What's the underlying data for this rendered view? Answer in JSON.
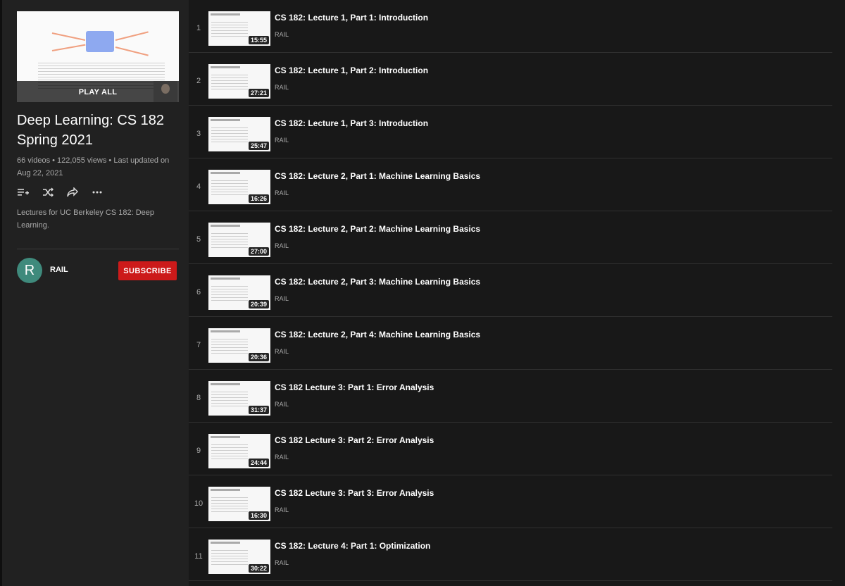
{
  "sidebar": {
    "play_all": "PLAY ALL",
    "title": "Deep Learning: CS 182 Spring 2021",
    "meta": "66 videos • 122,055 views • Last updated on Aug 22, 2021",
    "actions": [
      "add-to-queue-icon",
      "shuffle-icon",
      "share-icon",
      "more-icon"
    ],
    "description": "Lectures for UC Berkeley CS 182: Deep Learning.",
    "owner": {
      "initial": "R",
      "name": "RAIL",
      "avatar_color": "#3f8a7c"
    },
    "subscribe_label": "SUBSCRIBE",
    "subscribe_color": "#cc1a1a"
  },
  "videos": [
    {
      "index": "1",
      "title": "CS 182: Lecture 1, Part 1: Introduction",
      "channel": "RAIL",
      "duration": "15:55"
    },
    {
      "index": "2",
      "title": "CS 182: Lecture 1, Part 2: Introduction",
      "channel": "RAIL",
      "duration": "27:21"
    },
    {
      "index": "3",
      "title": "CS 182: Lecture 1, Part 3: Introduction",
      "channel": "RAIL",
      "duration": "25:47"
    },
    {
      "index": "4",
      "title": "CS 182: Lecture 2, Part 1: Machine Learning Basics",
      "channel": "RAIL",
      "duration": "16:26"
    },
    {
      "index": "5",
      "title": "CS 182: Lecture 2, Part 2: Machine Learning Basics",
      "channel": "RAIL",
      "duration": "27:00"
    },
    {
      "index": "6",
      "title": "CS 182: Lecture 2, Part 3: Machine Learning Basics",
      "channel": "RAIL",
      "duration": "20:39"
    },
    {
      "index": "7",
      "title": "CS 182: Lecture 2, Part 4: Machine Learning Basics",
      "channel": "RAIL",
      "duration": "20:36"
    },
    {
      "index": "8",
      "title": "CS 182 Lecture 3: Part 1: Error Analysis",
      "channel": "RAIL",
      "duration": "31:37"
    },
    {
      "index": "9",
      "title": "CS 182 Lecture 3: Part 2: Error Analysis",
      "channel": "RAIL",
      "duration": "24:44"
    },
    {
      "index": "10",
      "title": "CS 182 Lecture 3: Part 3: Error Analysis",
      "channel": "RAIL",
      "duration": "16:30"
    },
    {
      "index": "11",
      "title": "CS 182: Lecture 4: Part 1: Optimization",
      "channel": "RAIL",
      "duration": "30:22"
    }
  ]
}
